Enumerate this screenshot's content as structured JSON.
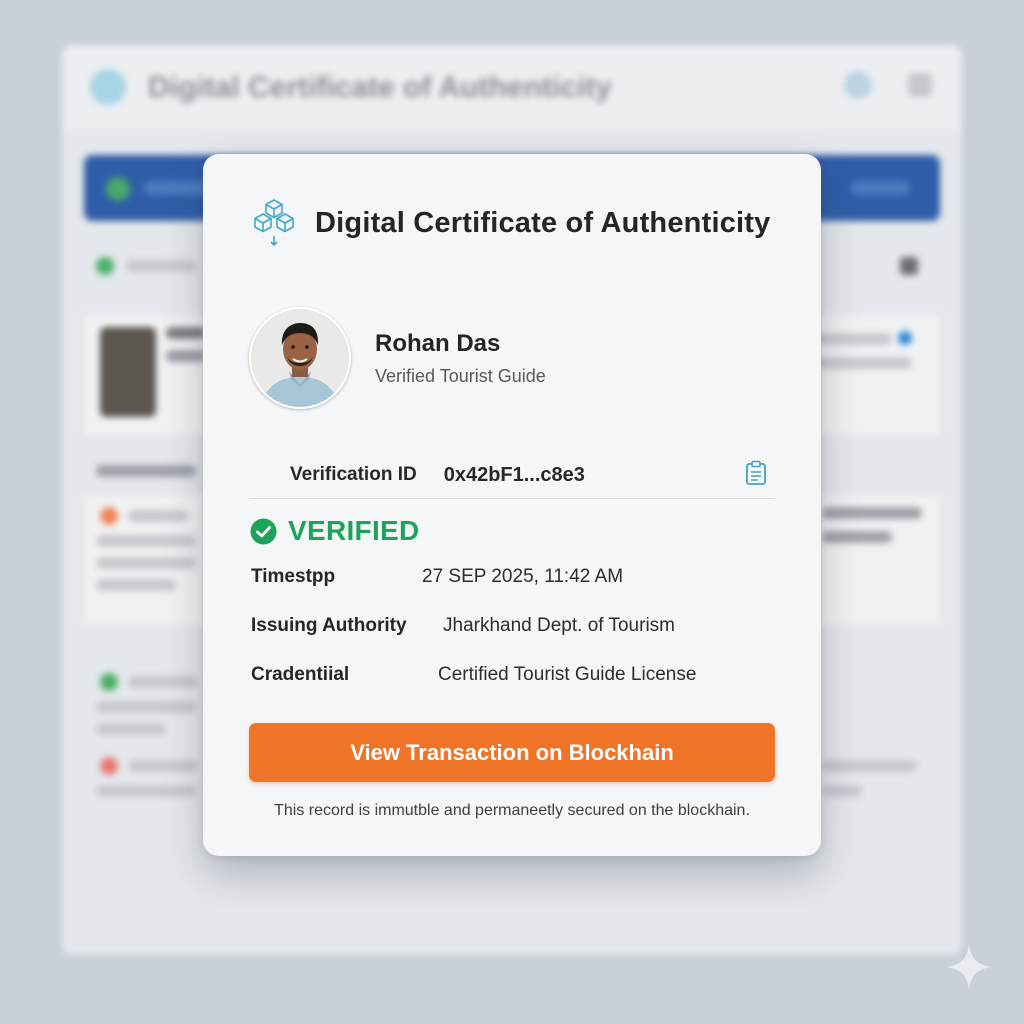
{
  "background": {
    "app_title": "Digital Certificate of Authenticity"
  },
  "dialog": {
    "title": "Digital Certificate of Authenticity",
    "icon": "blockchain-cubes-icon",
    "profile": {
      "name": "Rohan Das",
      "role": "Verified Tourist Guide"
    },
    "verification": {
      "label": "Verification ID",
      "value": "0x42bF1...c8e3",
      "copy_icon": "clipboard-icon"
    },
    "status": {
      "text": "VERIFIED",
      "color": "#1ea35a",
      "icon": "check-circle-icon"
    },
    "details": [
      {
        "label": "Timestpp",
        "value": "27 SEP 2025, 11:42 AM"
      },
      {
        "label": "Issuing Authority",
        "value": "Jharkhand Dept. of Tourism"
      },
      {
        "label": "Cradentiial",
        "value": "Certified Tourist Guide License"
      }
    ],
    "cta": {
      "label": "View Transaction on Blockhain",
      "color": "#f07428"
    },
    "footnote": "This record is immutble and permaneetly secured on the blockhain."
  },
  "colors": {
    "accent_orange": "#f07428",
    "verified_green": "#1ea35a",
    "icon_teal": "#3fa9c9"
  }
}
